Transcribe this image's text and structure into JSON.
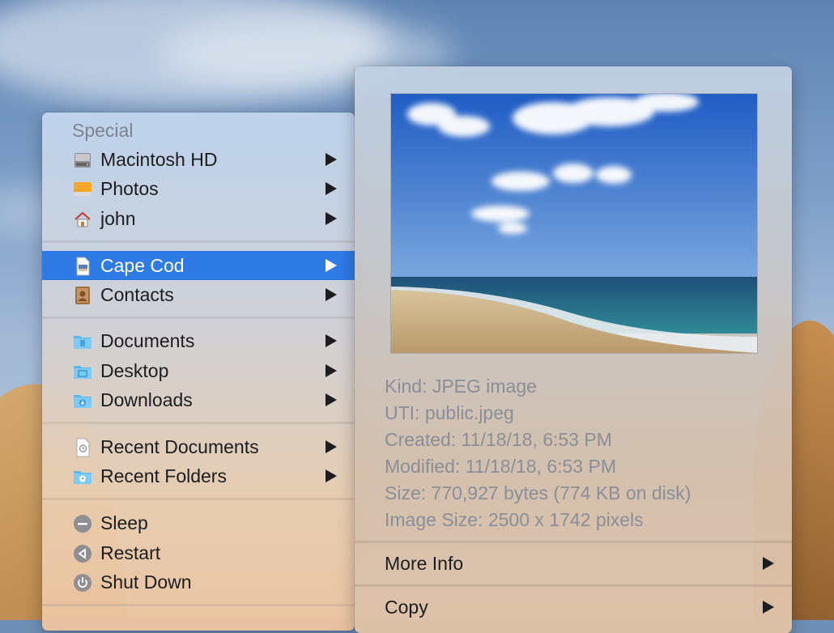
{
  "menu": {
    "header": "Special",
    "groups": [
      [
        {
          "label": "Macintosh HD",
          "icon": "hard-drive-icon",
          "submenu": true
        },
        {
          "label": "Photos",
          "icon": "external-drive-icon",
          "submenu": true
        },
        {
          "label": "john",
          "icon": "home-icon",
          "submenu": true
        }
      ],
      [
        {
          "label": "Cape Cod",
          "icon": "jpeg-document-icon",
          "submenu": true,
          "selected": true
        },
        {
          "label": "Contacts",
          "icon": "contacts-app-icon",
          "submenu": true
        }
      ],
      [
        {
          "label": "Documents",
          "icon": "documents-folder-icon",
          "submenu": true
        },
        {
          "label": "Desktop",
          "icon": "desktop-folder-icon",
          "submenu": true
        },
        {
          "label": "Downloads",
          "icon": "downloads-folder-icon",
          "submenu": true
        }
      ],
      [
        {
          "label": "Recent Documents",
          "icon": "recent-documents-icon",
          "submenu": true
        },
        {
          "label": "Recent Folders",
          "icon": "recent-folders-icon",
          "submenu": true
        }
      ],
      [
        {
          "label": "Sleep",
          "icon": "sleep-icon",
          "submenu": false
        },
        {
          "label": "Restart",
          "icon": "restart-icon",
          "submenu": false
        },
        {
          "label": "Shut Down",
          "icon": "shut-down-icon",
          "submenu": false
        }
      ]
    ],
    "selected_color": "#2f7be6"
  },
  "preview": {
    "image": "beach-photo",
    "info": [
      "Kind: JPEG image",
      "UTI: public.jpeg",
      "Created: 11/18/18, 6:53 PM",
      "Modified: 11/18/18, 6:53 PM",
      "Size: 770,927 bytes (774 KB on disk)",
      "Image Size: 2500 x 1742 pixels"
    ],
    "more_info_label": "More Info",
    "copy_label": "Copy"
  }
}
